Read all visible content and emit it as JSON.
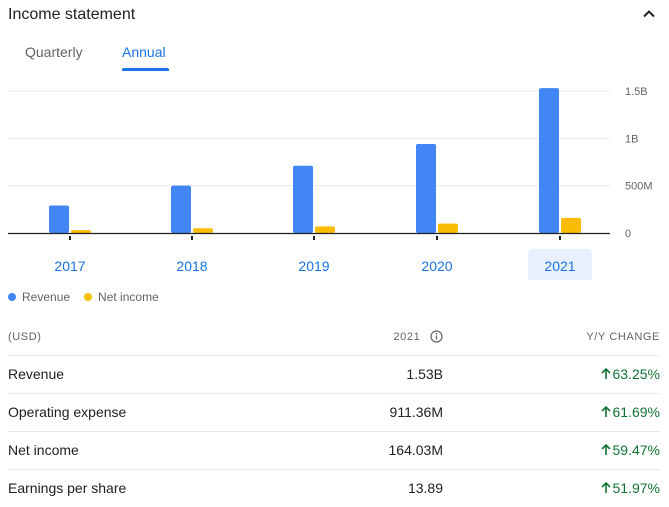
{
  "header": {
    "title": "Income statement"
  },
  "tabs": [
    {
      "label": "Quarterly",
      "active": false
    },
    {
      "label": "Annual",
      "active": true
    }
  ],
  "chart_data": {
    "type": "bar",
    "categories": [
      "2017",
      "2018",
      "2019",
      "2020",
      "2021"
    ],
    "selected_category": "2021",
    "series": [
      {
        "name": "Revenue",
        "color": "#4285f4",
        "values": [
          0.29,
          0.5,
          0.71,
          0.94,
          1.53
        ]
      },
      {
        "name": "Net income",
        "color": "#fbbc04",
        "values": [
          0.03,
          0.05,
          0.07,
          0.1,
          0.16
        ]
      }
    ],
    "yticks": [
      {
        "value": 0,
        "label": "0"
      },
      {
        "value": 0.5,
        "label": "500M"
      },
      {
        "value": 1.0,
        "label": "1B"
      },
      {
        "value": 1.5,
        "label": "1.5B"
      }
    ],
    "ylim": [
      0,
      1.5
    ],
    "grid": true,
    "legend_placement": "bottom-left"
  },
  "legend": [
    {
      "label": "Revenue",
      "color": "#4285f4"
    },
    {
      "label": "Net income",
      "color": "#fbbc04"
    }
  ],
  "table": {
    "header": {
      "label": "(USD)",
      "value": "2021",
      "change": "Y/Y CHANGE"
    },
    "rows": [
      {
        "label": "Revenue",
        "value": "1.53B",
        "change": "63.25%"
      },
      {
        "label": "Operating expense",
        "value": "911.36M",
        "change": "61.69%"
      },
      {
        "label": "Net income",
        "value": "164.03M",
        "change": "59.47%"
      },
      {
        "label": "Earnings per share",
        "value": "13.89",
        "change": "51.97%"
      }
    ]
  },
  "colors": {
    "accent": "#1a73e8",
    "positive": "#137333",
    "revenue": "#4285f4",
    "net_income": "#fbbc04"
  }
}
